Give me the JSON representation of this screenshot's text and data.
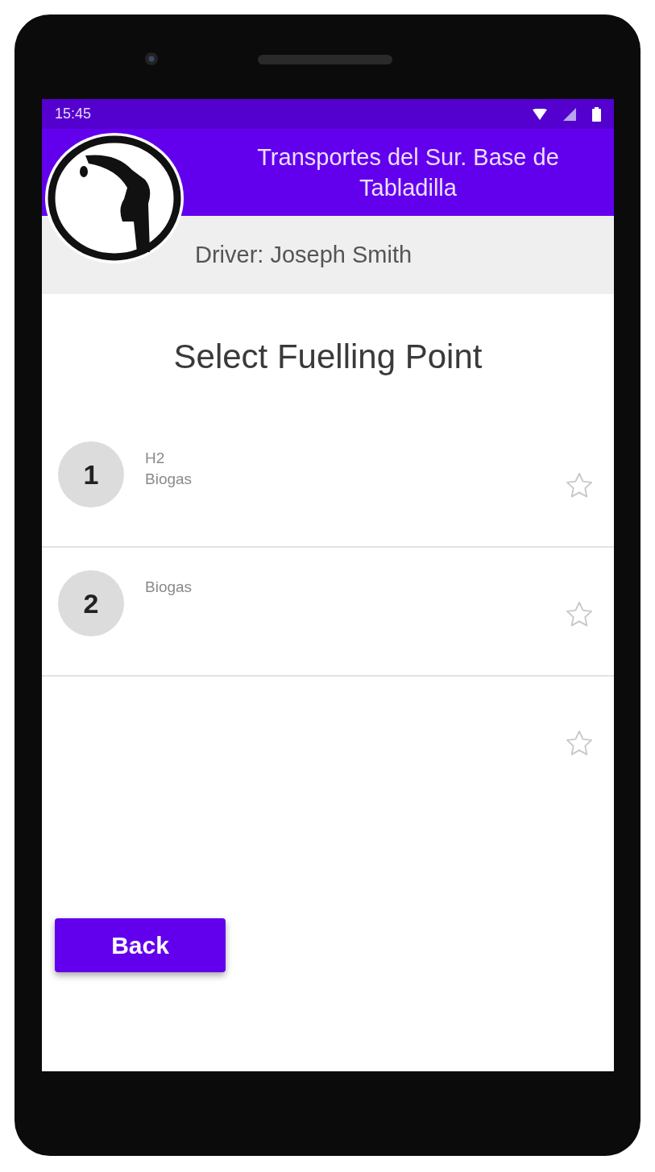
{
  "status_bar": {
    "time": "15:45"
  },
  "header": {
    "title": "Transportes del Sur. Base de Tabladilla",
    "driver": "Driver: Joseph Smith"
  },
  "page_title": "Select Fuelling Point",
  "fuelling_points": [
    {
      "number": "1",
      "fuels": [
        "H2",
        "Biogas"
      ],
      "favorite": false
    },
    {
      "number": "2",
      "fuels": [
        "Biogas"
      ],
      "favorite": false
    },
    {
      "favorite": false
    }
  ],
  "buttons": {
    "back": "Back"
  }
}
